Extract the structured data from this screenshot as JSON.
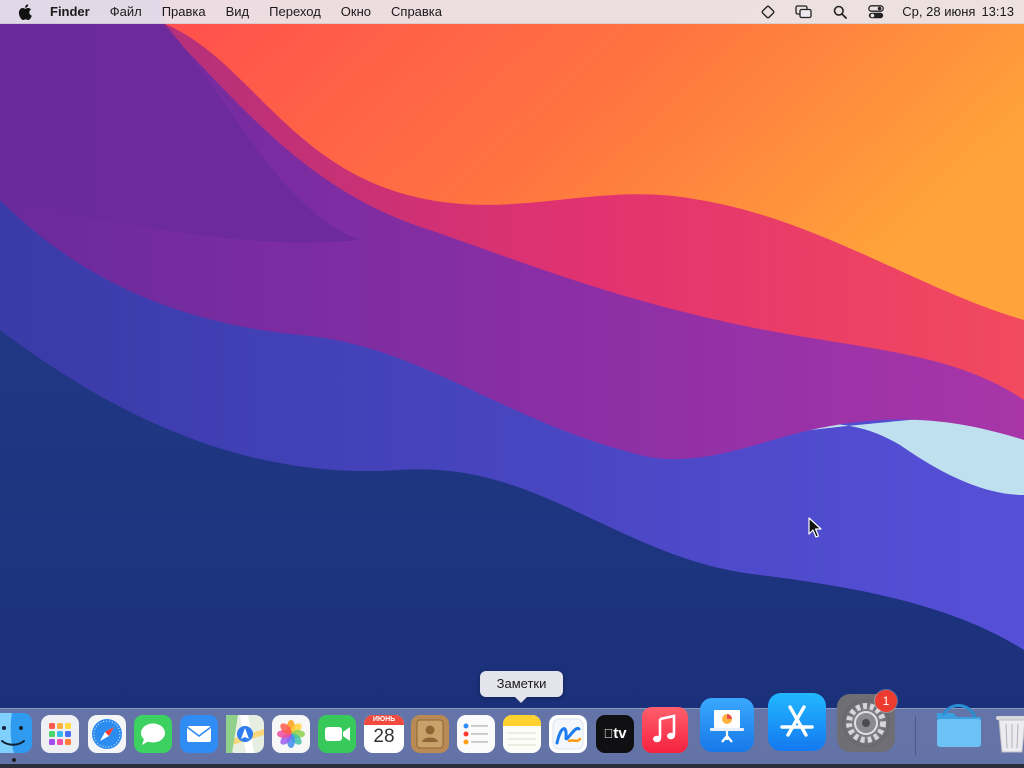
{
  "menubar": {
    "apple_icon": "apple-logo-icon",
    "app_name": "Finder",
    "menus": [
      "Файл",
      "Правка",
      "Вид",
      "Переход",
      "Окно",
      "Справка"
    ],
    "status_icons": [
      "diamond-icon",
      "screen-mirroring-icon",
      "spotlight-search-icon",
      "control-center-icon"
    ],
    "date": "Ср, 28 июня",
    "time": "13:13"
  },
  "dock": {
    "tooltip": "Заметки",
    "apps": [
      {
        "name": "Finder",
        "icon": "finder-icon",
        "running": true
      },
      {
        "name": "Launchpad",
        "icon": "launchpad-icon"
      },
      {
        "name": "Safari",
        "icon": "safari-icon"
      },
      {
        "name": "Messages",
        "icon": "messages-icon"
      },
      {
        "name": "Mail",
        "icon": "mail-icon"
      },
      {
        "name": "Maps",
        "icon": "maps-icon"
      },
      {
        "name": "Photos",
        "icon": "photos-icon"
      },
      {
        "name": "FaceTime",
        "icon": "facetime-icon"
      },
      {
        "name": "Calendar",
        "icon": "calendar-icon"
      },
      {
        "name": "Contacts",
        "icon": "contacts-icon"
      },
      {
        "name": "Reminders",
        "icon": "reminders-icon"
      },
      {
        "name": "Notes",
        "icon": "notes-icon"
      },
      {
        "name": "Freeform",
        "icon": "freeform-icon"
      },
      {
        "name": "TV",
        "icon": "apple-tv-icon"
      },
      {
        "name": "Music",
        "icon": "music-icon"
      },
      {
        "name": "Keynote",
        "icon": "keynote-icon"
      },
      {
        "name": "App Store",
        "icon": "app-store-icon"
      },
      {
        "name": "System Settings",
        "icon": "system-settings-icon"
      },
      {
        "name": "Downloads",
        "icon": "downloads-folder-icon"
      },
      {
        "name": "Trash",
        "icon": "trash-icon"
      }
    ],
    "calendar_month": "ИЮНЬ",
    "calendar_day": "28",
    "tv_label": "tv",
    "settings_badge": "1"
  },
  "colors": {
    "menubar_bg": "#ece8ee",
    "badge_red": "#ee3b30",
    "wallpaper_orange": "#ff8a3a",
    "wallpaper_purple": "#7a2ea0",
    "wallpaper_blue": "#2a3fa0"
  }
}
